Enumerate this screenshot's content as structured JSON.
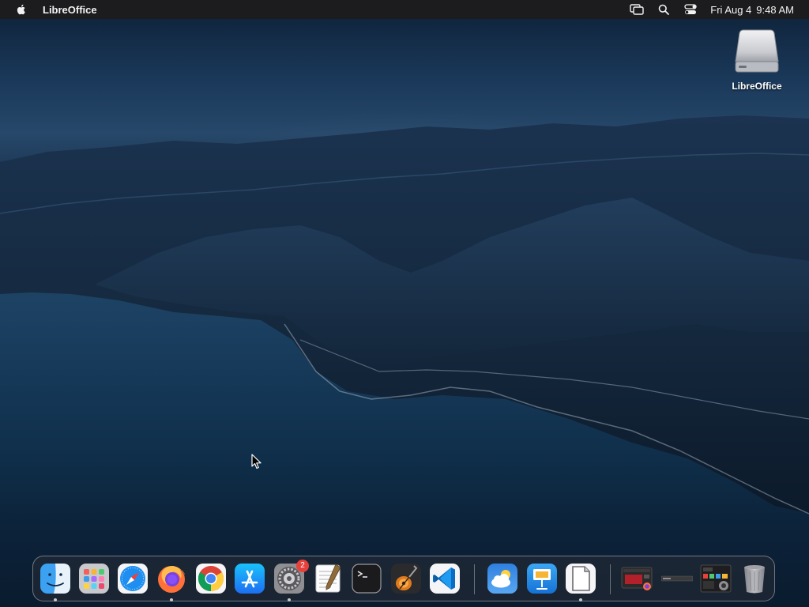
{
  "menubar": {
    "app_name": "LibreOffice",
    "clock_date": "Fri Aug 4",
    "clock_time": "9:48 AM",
    "icons": [
      "apple-icon",
      "screen-mirroring-icon",
      "spotlight-search-icon",
      "control-center-icon"
    ]
  },
  "desktop": {
    "drive_label": "LibreOffice"
  },
  "dock": {
    "apps": [
      {
        "name": "Finder",
        "icon": "finder-icon",
        "running": true
      },
      {
        "name": "Launchpad",
        "icon": "launchpad-icon",
        "running": false
      },
      {
        "name": "Safari",
        "icon": "safari-icon",
        "running": false
      },
      {
        "name": "Firefox",
        "icon": "firefox-icon",
        "running": true
      },
      {
        "name": "Google Chrome",
        "icon": "chrome-icon",
        "running": false
      },
      {
        "name": "App Store",
        "icon": "app-store-icon",
        "running": false
      },
      {
        "name": "System Preferences",
        "icon": "system-preferences-icon",
        "running": true,
        "badge": "2"
      },
      {
        "name": "TextEdit",
        "icon": "textedit-icon",
        "running": false
      },
      {
        "name": "Terminal",
        "icon": "terminal-icon",
        "running": false
      },
      {
        "name": "GarageBand",
        "icon": "garageband-icon",
        "running": false
      },
      {
        "name": "Visual Studio Code",
        "icon": "vscode-icon",
        "running": false
      },
      {
        "name": "Weather",
        "icon": "weather-icon",
        "running": false
      },
      {
        "name": "Keynote",
        "icon": "keynote-icon",
        "running": false
      },
      {
        "name": "LibreOffice",
        "icon": "libreoffice-icon",
        "running": true
      },
      {
        "name": "Minimized window 1",
        "icon": "minimized-window-icon",
        "running": false
      },
      {
        "name": "Minimized window 2",
        "icon": "minimized-window-icon",
        "running": false
      },
      {
        "name": "Minimized window 3",
        "icon": "minimized-window-icon",
        "running": false
      },
      {
        "name": "Trash",
        "icon": "trash-icon",
        "running": false
      }
    ]
  },
  "colors": {
    "menubar_bg": "#1c1c1e",
    "badge": "#e8413c",
    "desktop_sky": "#1b3a5c",
    "desktop_sea": "#10304c"
  }
}
